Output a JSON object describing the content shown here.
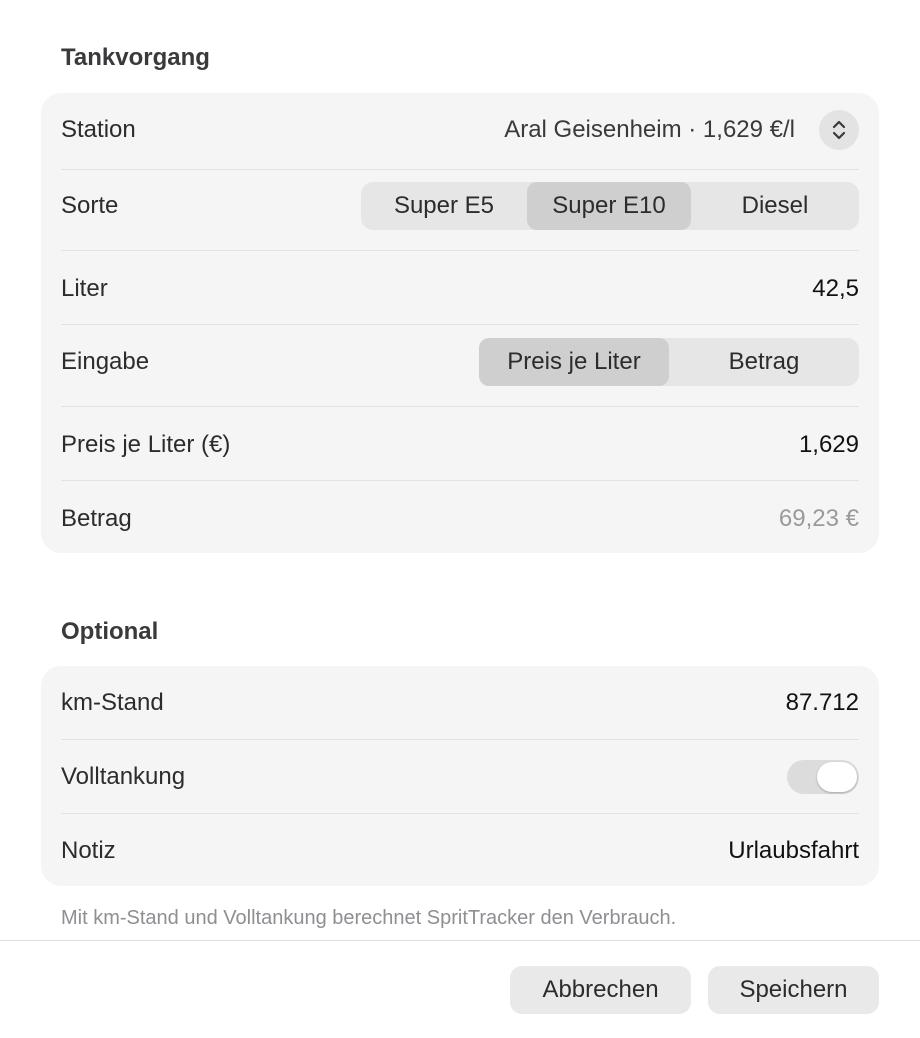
{
  "sections": {
    "tankvorgang_title": "Tankvorgang",
    "optional_title": "Optional"
  },
  "fueling": {
    "station_label": "Station",
    "station_value": "Aral Geisenheim · 1,629 €/l",
    "sorte_label": "Sorte",
    "sorte_options": [
      "Super E5",
      "Super E10",
      "Diesel"
    ],
    "sorte_selected": "Super E10",
    "liter_label": "Liter",
    "liter_value": "42,5",
    "eingabe_label": "Eingabe",
    "eingabe_options": [
      "Preis je Liter",
      "Betrag"
    ],
    "eingabe_selected": "Preis je Liter",
    "preis_label": "Preis je Liter (€)",
    "preis_value": "1,629",
    "betrag_label": "Betrag",
    "betrag_value": "69,23 €"
  },
  "optional": {
    "km_label": "km-Stand",
    "km_value": "87.712",
    "volltankung_label": "Volltankung",
    "volltankung_on": false,
    "notiz_label": "Notiz",
    "notiz_value": "Urlaubsfahrt",
    "footnote": "Mit km-Stand und Volltankung berechnet SpritTracker den Verbrauch."
  },
  "actions": {
    "cancel_label": "Abbrechen",
    "save_label": "Speichern"
  },
  "icons": {
    "station_picker": "chevron-up-down-icon"
  }
}
